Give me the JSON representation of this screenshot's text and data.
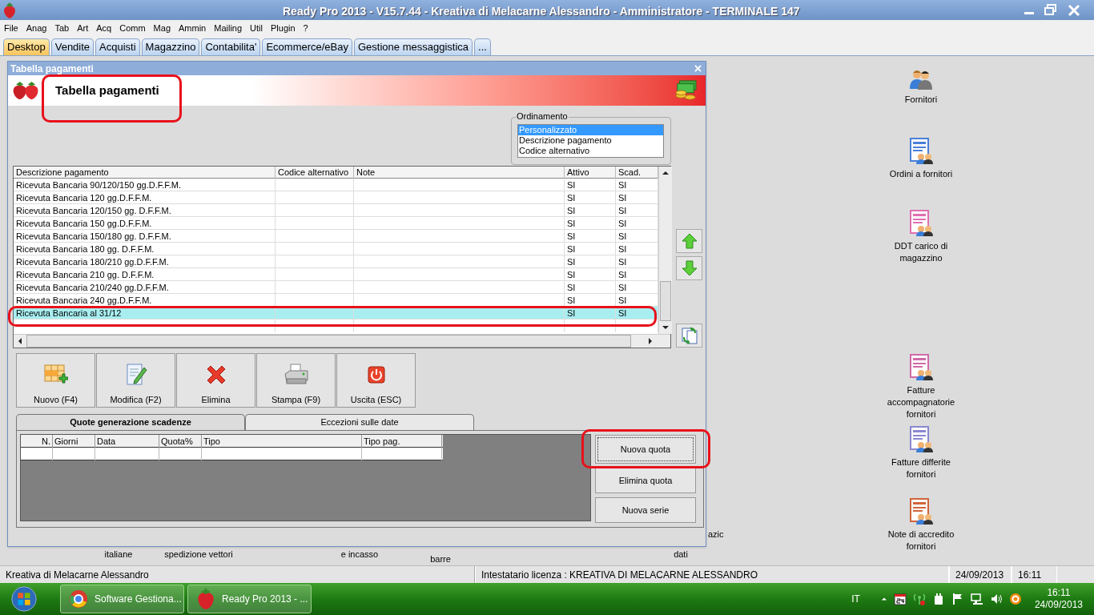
{
  "app_title": "Ready Pro 2013 - V15.7.44 - Kreativa di Melacarne Alessandro - Amministratore - TERMINALE 147",
  "menu": [
    "File",
    "Anag",
    "Tab",
    "Art",
    "Acq",
    "Comm",
    "Mag",
    "Ammin",
    "Mailing",
    "Util",
    "Plugin",
    "?"
  ],
  "tabs": [
    {
      "label": "Desktop",
      "selected": true
    },
    {
      "label": "Vendite",
      "selected": false
    },
    {
      "label": "Acquisti",
      "selected": false
    },
    {
      "label": "Magazzino",
      "selected": false
    },
    {
      "label": "Contabilita'",
      "selected": false
    },
    {
      "label": "Ecommerce/eBay",
      "selected": false
    },
    {
      "label": "Gestione messaggistica",
      "selected": false
    },
    {
      "label": "...",
      "selected": false
    }
  ],
  "dialog": {
    "title": "Tabella pagamenti",
    "header_title": "Tabella pagamenti",
    "ordering": {
      "label": "Ordinamento",
      "options": [
        {
          "label": "Personalizzato",
          "selected": true
        },
        {
          "label": "Descrizione pagamento",
          "selected": false
        },
        {
          "label": "Codice alternativo",
          "selected": false
        }
      ]
    },
    "table": {
      "columns": [
        "Descrizione pagamento",
        "Codice alternativo",
        "Note",
        "Attivo",
        "Scad."
      ],
      "rows": [
        {
          "description": "Ricevuta Bancaria 90/120/150 gg.D.F.F.M.",
          "active": "SI",
          "due": "SI",
          "selected": false
        },
        {
          "description": "Ricevuta Bancaria 120 gg.D.F.F.M.",
          "active": "SI",
          "due": "SI",
          "selected": false
        },
        {
          "description": "Ricevuta Bancaria 120/150 gg. D.F.F.M.",
          "active": "SI",
          "due": "SI",
          "selected": false
        },
        {
          "description": "Ricevuta Bancaria 150 gg.D.F.F.M.",
          "active": "SI",
          "due": "SI",
          "selected": false
        },
        {
          "description": "Ricevuta Bancaria 150/180 gg. D.F.F.M.",
          "active": "SI",
          "due": "SI",
          "selected": false
        },
        {
          "description": "Ricevuta Bancaria 180 gg. D.F.F.M.",
          "active": "SI",
          "due": "SI",
          "selected": false
        },
        {
          "description": "Ricevuta Bancaria 180/210 gg.D.F.F.M.",
          "active": "SI",
          "due": "SI",
          "selected": false
        },
        {
          "description": "Ricevuta Bancaria 210 gg. D.F.F.M.",
          "active": "SI",
          "due": "SI",
          "selected": false
        },
        {
          "description": "Ricevuta Bancaria 210/240 gg.D.F.F.M.",
          "active": "SI",
          "due": "SI",
          "selected": false
        },
        {
          "description": "Ricevuta Bancaria 240 gg.D.F.F.M.",
          "active": "SI",
          "due": "SI",
          "selected": false
        },
        {
          "description": "Ricevuta Bancaria al 31/12",
          "active": "SI",
          "due": "SI",
          "selected": true
        }
      ]
    },
    "toolbar": [
      {
        "label": "Nuovo (F4)",
        "kind": "new"
      },
      {
        "label": "Modifica (F2)",
        "kind": "edit"
      },
      {
        "label": "Elimina",
        "kind": "delete"
      },
      {
        "label": "Stampa (F9)",
        "kind": "print"
      },
      {
        "label": "Uscita (ESC)",
        "kind": "exit"
      }
    ],
    "subtabs": [
      {
        "label": "Quote generazione scadenze",
        "selected": true
      },
      {
        "label": "Eccezioni sulle date",
        "selected": false
      }
    ],
    "quote_columns": [
      "N.",
      "Giorni",
      "Data",
      "Quota%",
      "Tipo",
      "Tipo pag."
    ],
    "quote_buttons": [
      "Nuova quota",
      "Elimina quota",
      "Nuova serie"
    ]
  },
  "desktop_icons": [
    {
      "label": "Fornitori",
      "kind": "people"
    },
    {
      "label": "Ordini a fornitori",
      "kind": "document",
      "color": "#4a7fd8"
    },
    {
      "label": "DDT carico di magazzino",
      "kind": "document",
      "color": "#e070b0"
    },
    {
      "label": "Fatture accompagnatorie fornitori",
      "kind": "document",
      "color": "#d06aa8"
    },
    {
      "label": "Fatture differite fornitori",
      "kind": "document",
      "color": "#8a88d0"
    },
    {
      "label": "Note di accredito fornitori",
      "kind": "document",
      "color": "#d0643a"
    }
  ],
  "desktop_labels_behind": [
    "italiane",
    "spedizione vettori",
    "e incasso",
    "barre",
    "dati",
    "azic"
  ],
  "status_bar": [
    "Kreativa di Melacarne Alessandro",
    "Intestatario licenza : KREATIVA DI MELACARNE ALESSANDRO",
    "24/09/2013",
    "16:11"
  ],
  "taskbar": {
    "buttons": [
      {
        "label": "Software Gestiona...",
        "kind": "browser"
      },
      {
        "label": "Ready Pro 2013 - ...",
        "kind": "app"
      }
    ],
    "language": "IT",
    "time": "16:11",
    "date": "24/09/2013"
  }
}
